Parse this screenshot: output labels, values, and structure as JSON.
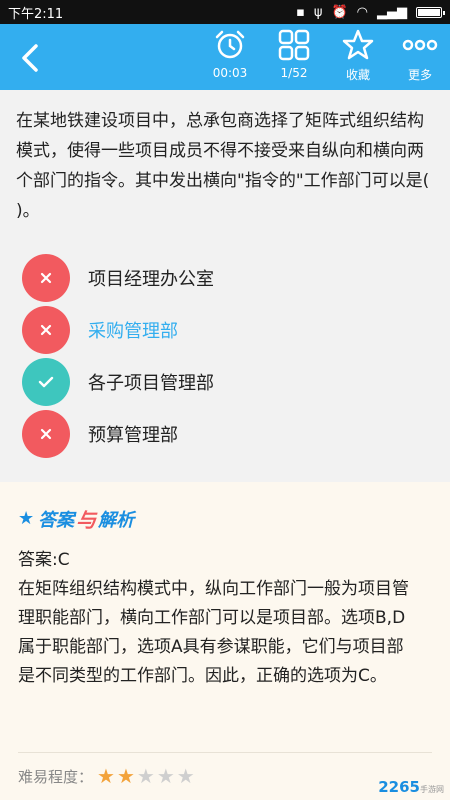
{
  "status_bar": {
    "time": "下午2:11"
  },
  "header": {
    "timer": "00:03",
    "progress": "1/52",
    "favorite_label": "收藏",
    "more_label": "更多"
  },
  "question": {
    "text": "在某地铁建设项目中，总承包商选择了矩阵式组织结构模式，使得一些项目成员不得不接受来自纵向和横向两个部门的指令。其中发出横向\"指令的\"工作部门可以是(   )。",
    "options": [
      {
        "label": "项目经理办公室",
        "state": "wrong"
      },
      {
        "label": "采购管理部",
        "state": "wrong-selected"
      },
      {
        "label": "各子项目管理部",
        "state": "correct"
      },
      {
        "label": "预算管理部",
        "state": "wrong"
      }
    ]
  },
  "analysis": {
    "title_a": "答案",
    "title_b": "与",
    "title_c": "解析",
    "answer_line": "答案:C",
    "explanation": "在矩阵组织结构模式中，纵向工作部门一般为项目管理职能部门，横向工作部门可以是项目部。选项B,D属于职能部门，选项A具有参谋职能，它们与项目部是不同类型的工作部门。因此，正确的选项为C。",
    "difficulty_label": "难易程度：",
    "difficulty_rating": 2,
    "difficulty_max": 5
  },
  "watermark": {
    "brand": "2265",
    "sub": "手游网"
  },
  "colors": {
    "header": "#33aeef",
    "wrong": "#f25a5f",
    "correct": "#3ec6be",
    "star": "#f3a33b"
  }
}
